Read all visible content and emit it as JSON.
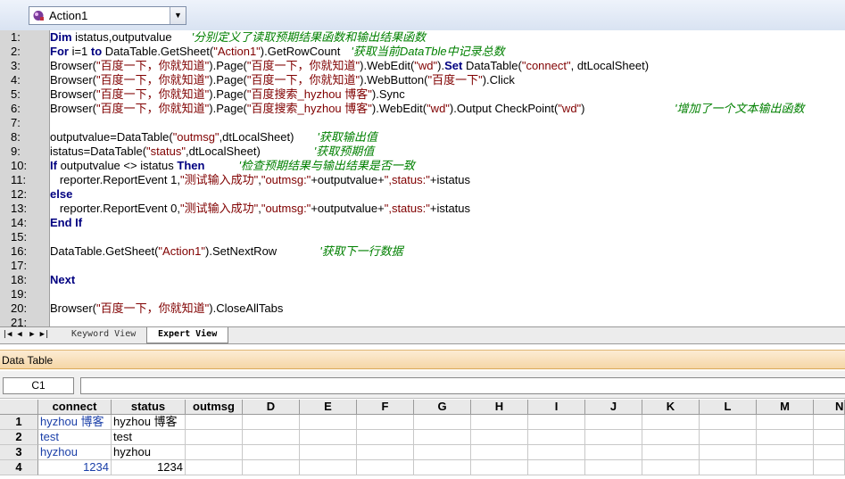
{
  "toolbar": {
    "action_name": "Action1",
    "action_icon": "action-icon"
  },
  "editor": {
    "lines": [
      {
        "n": "1:"
      },
      {
        "n": "2:"
      },
      {
        "n": "3:"
      },
      {
        "n": "4:"
      },
      {
        "n": "5:"
      },
      {
        "n": "6:"
      },
      {
        "n": "7:"
      },
      {
        "n": "8:"
      },
      {
        "n": "9:"
      },
      {
        "n": "10:"
      },
      {
        "n": "11:"
      },
      {
        "n": "12:"
      },
      {
        "n": "13:"
      },
      {
        "n": "14:"
      },
      {
        "n": "15:"
      },
      {
        "n": "16:"
      },
      {
        "n": "17:"
      },
      {
        "n": "18:"
      },
      {
        "n": "19:"
      },
      {
        "n": "20:"
      },
      {
        "n": "21:"
      }
    ],
    "code": {
      "l1": {
        "kw": "Dim",
        "rest": " istatus,outputvalue",
        "cm": "'分别定义了读取预期结果函数和输出结果函数"
      },
      "l2": {
        "kw1": "For",
        "a": " i=1 ",
        "kw2": "to",
        "b": " DataTable.GetSheet(",
        "s1": "\"Action1\"",
        "c": ").GetRowCount",
        "cm": "'获取当前DataTble中记录总数"
      },
      "l3": {
        "a": "Browser(",
        "s1": "\"百度一下，你就知道\"",
        "b": ").Page(",
        "s2": "\"百度一下，你就知道\"",
        "c": ").WebEdit(",
        "s3": "\"wd\"",
        "d": ").",
        "kw": "Set",
        "e": " DataTable(",
        "s4": "\"connect\"",
        "f": ", dtLocalSheet)"
      },
      "l4": {
        "a": "Browser(",
        "s1": "\"百度一下，你就知道\"",
        "b": ").Page(",
        "s2": "\"百度一下，你就知道\"",
        "c": ").WebButton(",
        "s3": "\"百度一下\"",
        "d": ").Click"
      },
      "l5": {
        "a": "Browser(",
        "s1": "\"百度一下，你就知道\"",
        "b": ").Page(",
        "s2": "\"百度搜索_hyzhou 博客\"",
        "c": ").Sync"
      },
      "l6": {
        "a": "Browser(",
        "s1": "\"百度一下，你就知道\"",
        "b": ").Page(",
        "s2": "\"百度搜索_hyzhou 博客\"",
        "c": ").WebEdit(",
        "s3": "\"wd\"",
        "d": ").Output CheckPoint(",
        "s4": "\"wd\"",
        "e": ")",
        "cm": "'增加了一个文本输出函数"
      },
      "l8": {
        "a": "outputvalue=DataTable(",
        "s1": "\"outmsg\"",
        "b": ",dtLocalSheet)",
        "cm": "'获取输出值"
      },
      "l9": {
        "a": "istatus=DataTable(",
        "s1": "\"status\"",
        "b": ",dtLocalSheet)",
        "cm": "'获取预期值"
      },
      "l10": {
        "kw1": "If",
        "a": " outputvalue <> istatus ",
        "kw2": "Then",
        "cm": "'检查预期结果与输出结果是否一致"
      },
      "l11": {
        "a": "   reporter.ReportEvent 1,",
        "s1": "\"测试输入成功\"",
        "b": ",",
        "s2": "\"outmsg:\"",
        "c": "+outputvalue+",
        "s3": "\",status:\"",
        "d": "+istatus"
      },
      "l12": {
        "kw": "else"
      },
      "l13": {
        "a": "   reporter.ReportEvent 0,",
        "s1": "\"测试输入成功\"",
        "b": ",",
        "s2": "\"outmsg:\"",
        "c": "+outputvalue+",
        "s3": "\",status:\"",
        "d": "+istatus"
      },
      "l14": {
        "kw": "End If"
      },
      "l16": {
        "a": "DataTable.GetSheet(",
        "s1": "\"Action1\"",
        "b": ").SetNextRow",
        "cm": "'获取下一行数据"
      },
      "l18": {
        "kw": "Next"
      },
      "l20": {
        "a": "Browser(",
        "s1": "\"百度一下，你就知道\"",
        "b": ").CloseAllTabs"
      }
    }
  },
  "tabs": {
    "keyword": "Keyword View",
    "expert": "Expert View"
  },
  "datatable": {
    "title": "Data Table",
    "cell_ref": "C1",
    "columns": [
      "connect",
      "status",
      "outmsg",
      "D",
      "E",
      "F",
      "G",
      "H",
      "I",
      "J",
      "K",
      "L",
      "M",
      "N"
    ],
    "rows": [
      {
        "n": "1",
        "connect": "hyzhou 博客",
        "status": "hyzhou 博客"
      },
      {
        "n": "2",
        "connect": "test",
        "status": "test"
      },
      {
        "n": "3",
        "connect": "hyzhou",
        "status": "hyzhou"
      },
      {
        "n": "4",
        "connect": "1234",
        "status": "1234"
      }
    ]
  },
  "colors": {
    "keyword": "#000080",
    "string": "#800000",
    "comment": "#008000",
    "datatable_header": "#f5d6a6"
  }
}
